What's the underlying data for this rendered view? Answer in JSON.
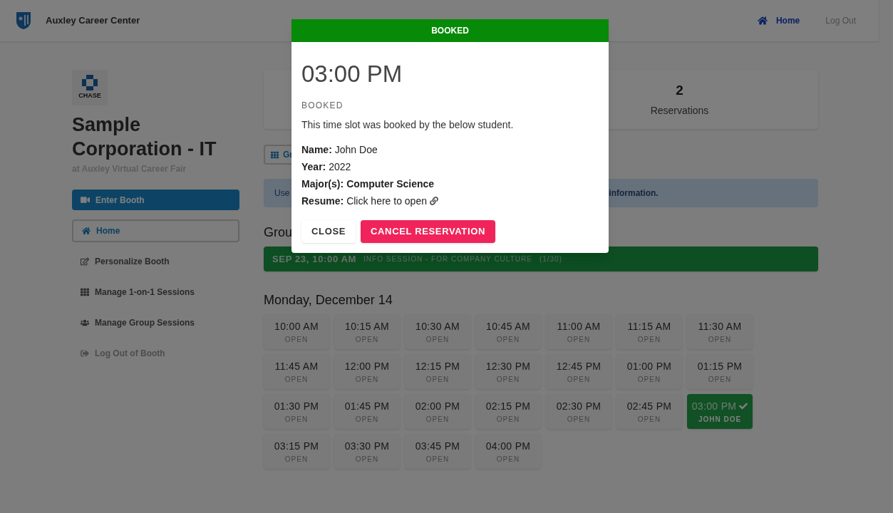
{
  "header": {
    "title": "Auxley Career Center",
    "nav": [
      {
        "label": "Home",
        "selected": true
      },
      {
        "label": "Log Out",
        "selected": false
      }
    ]
  },
  "sidebar": {
    "logo_text": "CHASE",
    "title": "Sample Corporation - IT",
    "subtitle": "at Auxley Virtual Career Fair",
    "enter_button": "Enter Booth",
    "items": [
      {
        "label": "Home",
        "selected": true,
        "disabled": false
      },
      {
        "label": "Personalize Booth",
        "selected": false,
        "disabled": false
      },
      {
        "label": "Manage 1-on-1 Sessions",
        "selected": false,
        "disabled": false
      },
      {
        "label": "Manage Group Sessions",
        "selected": false,
        "disabled": false
      },
      {
        "label": "Log Out of Booth",
        "selected": false,
        "disabled": true
      }
    ]
  },
  "stats": {
    "value": "2",
    "label": "Reservations"
  },
  "group_button": "Gr",
  "alert": {
    "text_start": "Use",
    "text_end": "information."
  },
  "group_heading": "Grou",
  "group_session": {
    "date": "SEP 23, 10:00 AM",
    "title": "INFO SESSION - FOR COMPANY CULTURE",
    "count": "(1/30)"
  },
  "day_heading": "Monday, December 14",
  "slots": [
    {
      "time": "10:00 AM",
      "status": "OPEN",
      "kind": "open"
    },
    {
      "time": "10:15 AM",
      "status": "OPEN",
      "kind": "open"
    },
    {
      "time": "10:30 AM",
      "status": "OPEN",
      "kind": "open"
    },
    {
      "time": "10:45 AM",
      "status": "OPEN",
      "kind": "open"
    },
    {
      "time": "11:00 AM",
      "status": "OPEN",
      "kind": "open"
    },
    {
      "time": "11:15 AM",
      "status": "OPEN",
      "kind": "open"
    },
    {
      "time": "11:30 AM",
      "status": "OPEN",
      "kind": "open"
    },
    {
      "time": "11:45 AM",
      "status": "OPEN",
      "kind": "open"
    },
    {
      "time": "12:00 PM",
      "status": "OPEN",
      "kind": "open"
    },
    {
      "time": "12:15 PM",
      "status": "OPEN",
      "kind": "open"
    },
    {
      "time": "12:30 PM",
      "status": "OPEN",
      "kind": "open"
    },
    {
      "time": "12:45 PM",
      "status": "OPEN",
      "kind": "open"
    },
    {
      "time": "01:00 PM",
      "status": "OPEN",
      "kind": "open"
    },
    {
      "time": "01:15 PM",
      "status": "OPEN",
      "kind": "open"
    },
    {
      "time": "01:30 PM",
      "status": "OPEN",
      "kind": "open"
    },
    {
      "time": "01:45 PM",
      "status": "OPEN",
      "kind": "open"
    },
    {
      "time": "02:00 PM",
      "status": "OPEN",
      "kind": "open"
    },
    {
      "time": "02:15 PM",
      "status": "OPEN",
      "kind": "open"
    },
    {
      "time": "02:30 PM",
      "status": "OPEN",
      "kind": "open"
    },
    {
      "time": "02:45 PM",
      "status": "OPEN",
      "kind": "open"
    },
    {
      "time": "03:00 PM",
      "status": "JOHN DOE",
      "kind": "booked"
    },
    {
      "time": "03:15 PM",
      "status": "OPEN",
      "kind": "open"
    },
    {
      "time": "03:30 PM",
      "status": "OPEN",
      "kind": "open"
    },
    {
      "time": "03:45 PM",
      "status": "OPEN",
      "kind": "open"
    },
    {
      "time": "04:00 PM",
      "status": "OPEN",
      "kind": "open"
    }
  ],
  "modal": {
    "header": "BOOKED",
    "time": "03:00 PM",
    "status": "BOOKED",
    "message": "This time slot was booked by the below student.",
    "details": [
      {
        "label": "Name:",
        "value": "John Doe",
        "bold_value": false,
        "kind": "text"
      },
      {
        "label": "Year:",
        "value": "2022",
        "bold_value": false,
        "kind": "text"
      },
      {
        "label": "Major(s):",
        "value": "Computer Science",
        "bold_value": true,
        "kind": "text"
      },
      {
        "label": "Resume:",
        "value": "Click here to open",
        "bold_value": false,
        "kind": "link"
      }
    ],
    "buttons": [
      {
        "label": "CLOSE",
        "kind": "plain"
      },
      {
        "label": "CANCEL RESERVATION",
        "kind": "danger"
      }
    ]
  }
}
